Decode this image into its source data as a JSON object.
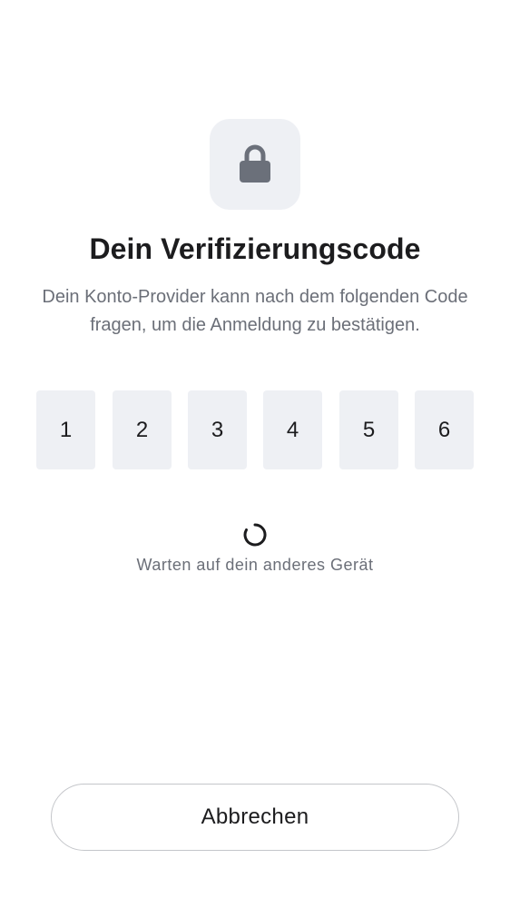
{
  "header": {
    "icon": "lock-icon",
    "title": "Dein Verifizierungscode",
    "subtitle": "Dein Konto-Provider kann nach dem folgenden Code fragen, um die Anmeldung zu bestätigen."
  },
  "code": {
    "digits": [
      "1",
      "2",
      "3",
      "4",
      "5",
      "6"
    ]
  },
  "status": {
    "icon": "loading-spinner-icon",
    "text": "Warten auf dein anderes Gerät"
  },
  "actions": {
    "cancel_label": "Abbrechen"
  },
  "colors": {
    "tile_background": "#eef0f4",
    "lock_icon": "#6b707a",
    "title_text": "#1c1c1e",
    "secondary_text": "#6b6f78",
    "button_border": "#c4c6ca"
  }
}
